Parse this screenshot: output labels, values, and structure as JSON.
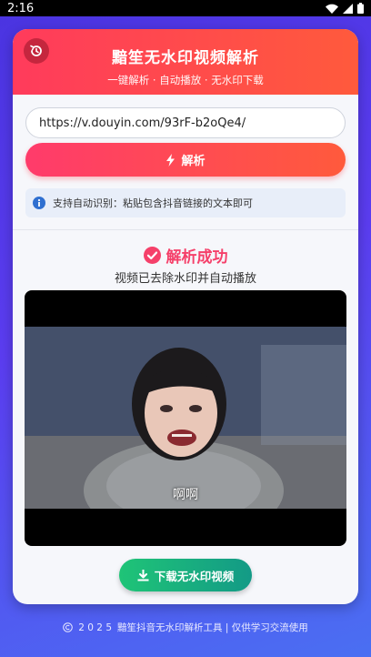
{
  "status_bar": {
    "time": "2:16"
  },
  "header": {
    "title": "黯笙无水印视频解析",
    "subtitle": "一键解析 · 自动播放 · 无水印下载"
  },
  "input": {
    "value": "https://v.douyin.com/93rF-b2oQe4/"
  },
  "parse_button": {
    "label": "解析"
  },
  "tip": {
    "text": "支持自动识别：粘贴包含抖音链接的文本即可"
  },
  "result": {
    "title": "解析成功",
    "description": "视频已去除水印并自动播放",
    "video_subtitle": "啊啊"
  },
  "download_button": {
    "label": "下载无水印视频"
  },
  "footer": {
    "year": "2 0 2 5",
    "text": "黯笙抖音无水印解析工具 | 仅供学习交流使用"
  },
  "colors": {
    "accent": "#ff3b5c",
    "success": "#f5406a",
    "download": "#1fc477",
    "background": "#4a34e0"
  }
}
